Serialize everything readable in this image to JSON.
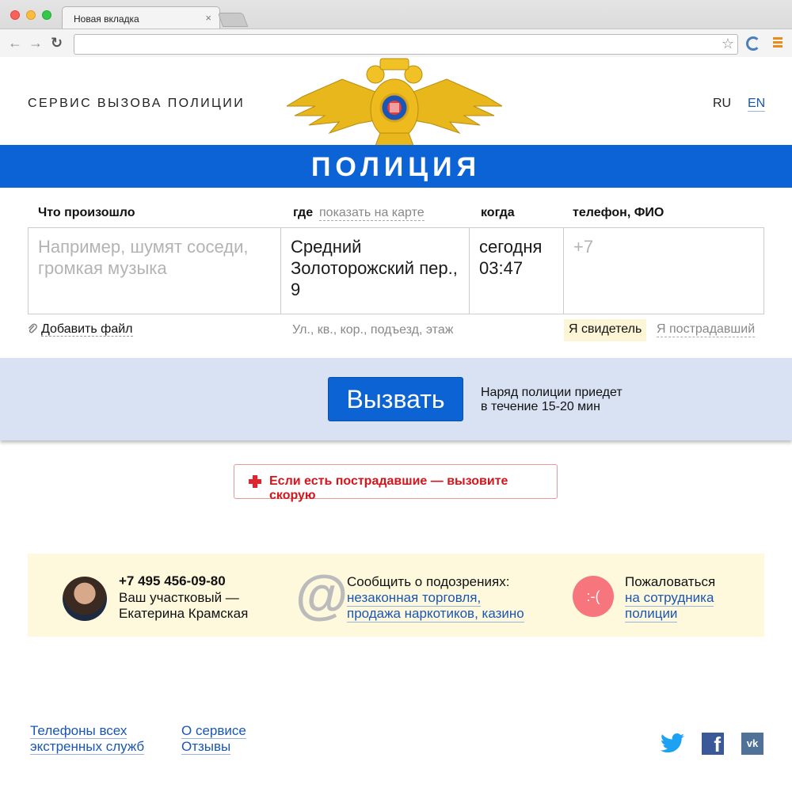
{
  "browser": {
    "tab_title": "Новая вкладка",
    "tab_close": "×",
    "back_icon": "arrow-left-icon",
    "forward_icon": "arrow-right-icon",
    "reload_icon": "reload-icon",
    "address_value": "",
    "menu_color": "#e98c1e"
  },
  "header": {
    "service_title": "СЕРВИС ВЫЗОВА ПОЛИЦИИ",
    "lang_ru": "RU",
    "lang_en": "EN",
    "banner": "ПОЛИЦИЯ",
    "banner_color": "#0b63d6"
  },
  "form": {
    "what_label": "Что произошло",
    "where_label": "где",
    "map_link": "показать на карте",
    "when_label": "когда",
    "phone_label": "телефон, ФИО",
    "what_placeholder": "Например, шумят соседи, громкая музыка",
    "where_value": "Средний Золоторожский пер., 9",
    "when_day": "сегодня",
    "when_time": "03:47",
    "phone_placeholder": "+7",
    "attach_label": "Добавить файл",
    "address_hint": "Ул., кв., кор., подъезд, этаж",
    "witness": "Я свидетель",
    "victim": "Я пострадавший"
  },
  "call": {
    "button": "Вызвать",
    "eta_line1": "Наряд полиции приедет",
    "eta_line2": "в течение 15-20 мин"
  },
  "ambulance": {
    "text": "Если есть пострадавшие — вызовите скорую"
  },
  "info": {
    "officer_phone": "+7 495 456-09-80",
    "officer_line1": "Ваш участковый —",
    "officer_line2": "Екатерина Крамская",
    "report_title": "Сообщить о подозрениях:",
    "report_link1": "незаконная торговля,",
    "report_link2": "продажа наркотиков, казино",
    "complain_icon": ":-(",
    "complain_title": "Пожаловаться",
    "complain_link1": "на сотрудника",
    "complain_link2": "полиции"
  },
  "footer": {
    "emergency_line1": "Телефоны всех",
    "emergency_line2": "экстренных служб",
    "about": "О сервисе",
    "reviews": "Отзывы",
    "social": [
      "twitter-icon",
      "facebook-icon",
      "vk-icon"
    ]
  }
}
